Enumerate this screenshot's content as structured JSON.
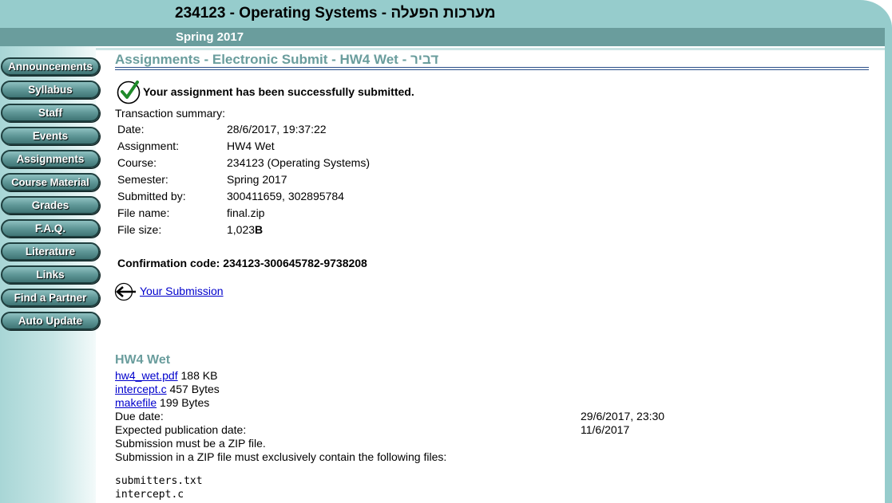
{
  "header": {
    "title": "234123 - Operating Systems - מערכות הפעלה",
    "semester": "Spring 2017"
  },
  "sidebar": {
    "items": [
      {
        "label": "Announcements"
      },
      {
        "label": "Syllabus"
      },
      {
        "label": "Staff"
      },
      {
        "label": "Events"
      },
      {
        "label": "Assignments"
      },
      {
        "label": "Course Material"
      },
      {
        "label": "Grades"
      },
      {
        "label": "F.A.Q."
      },
      {
        "label": "Literature"
      },
      {
        "label": "Links"
      },
      {
        "label": "Find a Partner"
      },
      {
        "label": "Auto Update"
      }
    ]
  },
  "main": {
    "title": "Assignments - Electronic Submit - HW4 Wet - דביר",
    "success_message": "Your assignment has been successfully submitted.",
    "transaction_label": "Transaction summary:",
    "summary": [
      {
        "label": "Date:",
        "value": "28/6/2017, 19:37:22"
      },
      {
        "label": "Assignment:",
        "value": "HW4 Wet"
      },
      {
        "label": "Course:",
        "value": "234123 (Operating Systems)"
      },
      {
        "label": "Semester:",
        "value": "Spring 2017"
      },
      {
        "label": "Submitted by:",
        "value": "300411659, 302895784"
      },
      {
        "label": "File name:",
        "value": "final.zip"
      },
      {
        "label": "File size:",
        "value": "1,023",
        "unit": "B"
      }
    ],
    "confirmation": "Confirmation code: 234123-300645782-9738208",
    "back_link": "Your Submission",
    "assignment": {
      "title": "HW4 Wet",
      "files": [
        {
          "name": "hw4_wet.pdf",
          "size": "188 KB"
        },
        {
          "name": "intercept.c",
          "size": "457 Bytes"
        },
        {
          "name": "makefile",
          "size": "199 Bytes"
        }
      ],
      "due_label": "Due date:",
      "due_value": "29/6/2017, 23:30",
      "pub_label": "Expected publication date:",
      "pub_value": "11/6/2017",
      "zip_note": "Submission must be a ZIP file.",
      "contents_note": "Submission in a ZIP file must exclusively contain the following files:",
      "required_files": [
        "submitters.txt",
        "intercept.c"
      ]
    }
  },
  "colors": {
    "header_light": "#96cccc",
    "header_dark": "#6a9d9d",
    "title_teal": "#6a9d9d",
    "link": "#0000cc"
  }
}
